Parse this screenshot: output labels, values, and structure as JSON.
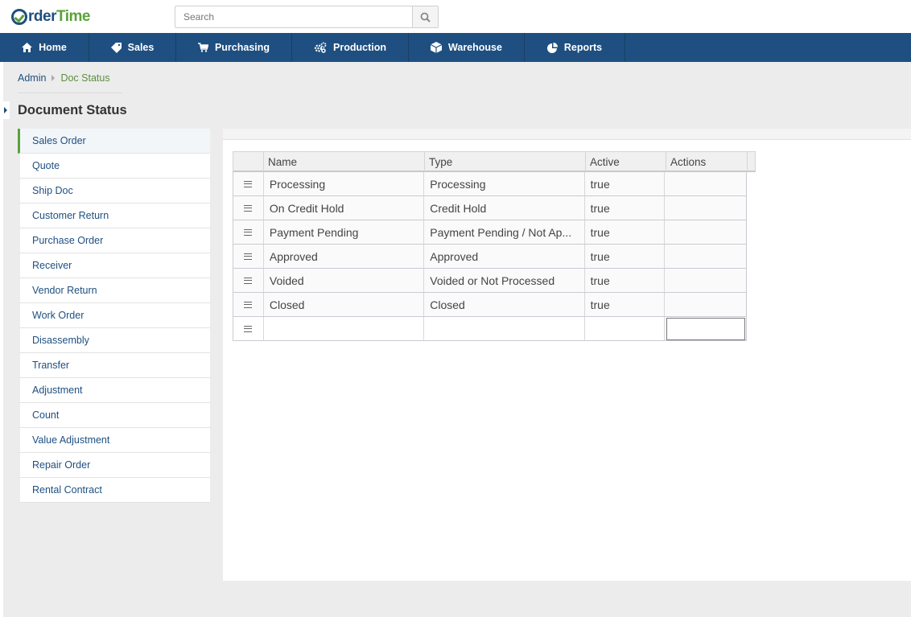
{
  "app": {
    "logo_part1": "rder",
    "logo_part2": "Time"
  },
  "search": {
    "placeholder": "Search",
    "value": ""
  },
  "nav": {
    "items": [
      {
        "label": "Home",
        "icon": "home-icon"
      },
      {
        "label": "Sales",
        "icon": "tag-icon"
      },
      {
        "label": "Purchasing",
        "icon": "cart-icon"
      },
      {
        "label": "Production",
        "icon": "gears-icon"
      },
      {
        "label": "Warehouse",
        "icon": "box-icon"
      },
      {
        "label": "Reports",
        "icon": "pie-chart-icon"
      }
    ]
  },
  "breadcrumb": {
    "parent": "Admin",
    "current": "Doc Status"
  },
  "page": {
    "title": "Document Status"
  },
  "sidebar": {
    "items": [
      {
        "label": "Sales Order",
        "active": true
      },
      {
        "label": "Quote"
      },
      {
        "label": "Ship Doc"
      },
      {
        "label": "Customer Return"
      },
      {
        "label": "Purchase Order"
      },
      {
        "label": "Receiver"
      },
      {
        "label": "Vendor Return"
      },
      {
        "label": "Work Order"
      },
      {
        "label": "Disassembly"
      },
      {
        "label": "Transfer"
      },
      {
        "label": "Adjustment"
      },
      {
        "label": "Count"
      },
      {
        "label": "Value Adjustment"
      },
      {
        "label": "Repair Order"
      },
      {
        "label": "Rental Contract"
      }
    ]
  },
  "grid": {
    "columns": [
      "Name",
      "Type",
      "Active",
      "Actions"
    ],
    "rows": [
      {
        "name": "Processing",
        "type": "Processing",
        "active": "true"
      },
      {
        "name": "On Credit Hold",
        "type": "Credit Hold",
        "active": "true"
      },
      {
        "name": "Payment Pending",
        "type": "Payment Pending / Not Ap...",
        "active": "true"
      },
      {
        "name": "Approved",
        "type": "Approved",
        "active": "true"
      },
      {
        "name": "Voided",
        "type": "Voided or Not Processed",
        "active": "true"
      },
      {
        "name": "Closed",
        "type": "Closed",
        "active": "true"
      }
    ]
  },
  "colors": {
    "brand_blue": "#1e4f80",
    "brand_green": "#5aa23a"
  }
}
